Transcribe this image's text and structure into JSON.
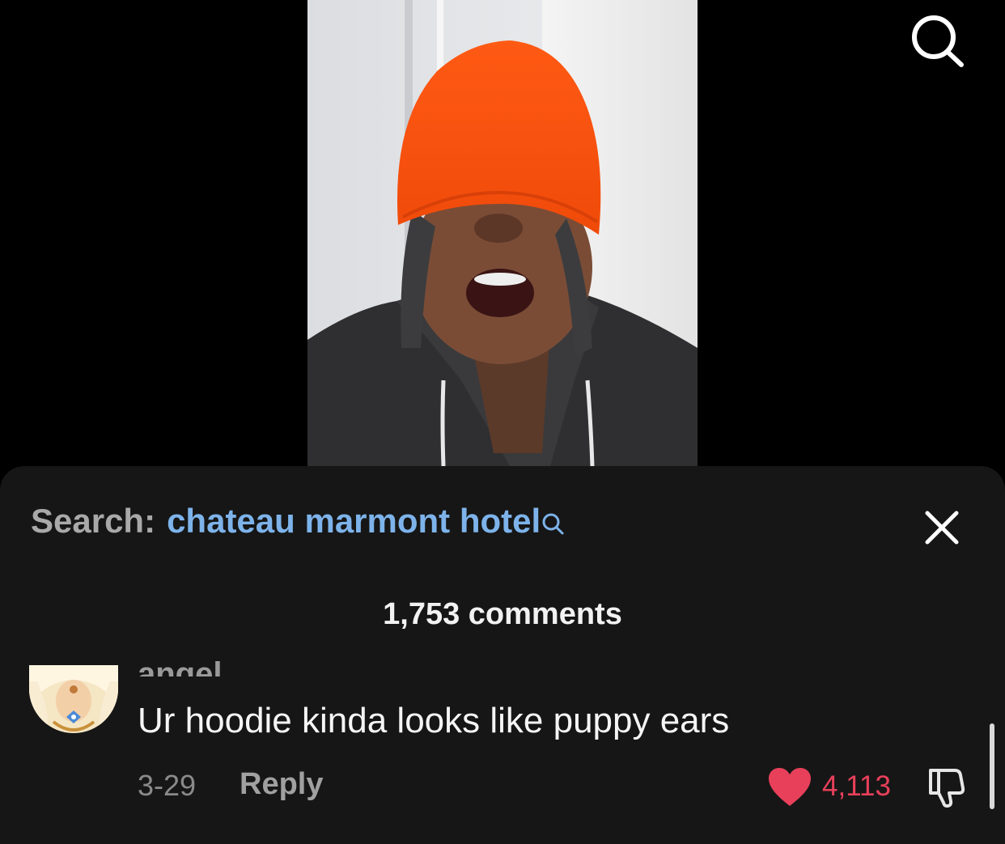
{
  "header": {
    "search_icon": "search-icon"
  },
  "comments_panel": {
    "search_label": "Search:",
    "search_query": "chateau marmont hotel",
    "search_query_icon": "search-icon",
    "close_icon": "close-icon",
    "comment_count": "1,753 comments"
  },
  "comment": {
    "username": "angel",
    "text": "Ur hoodie kinda looks like puppy ears",
    "date": "3-29",
    "reply_label": "Reply",
    "likes": "4,113",
    "like_icon": "heart-icon",
    "dislike_icon": "thumbs-down-icon"
  },
  "colors": {
    "background": "#000000",
    "sheet": "#161616",
    "accent_link": "#7db3ea",
    "like": "#e8405a"
  }
}
